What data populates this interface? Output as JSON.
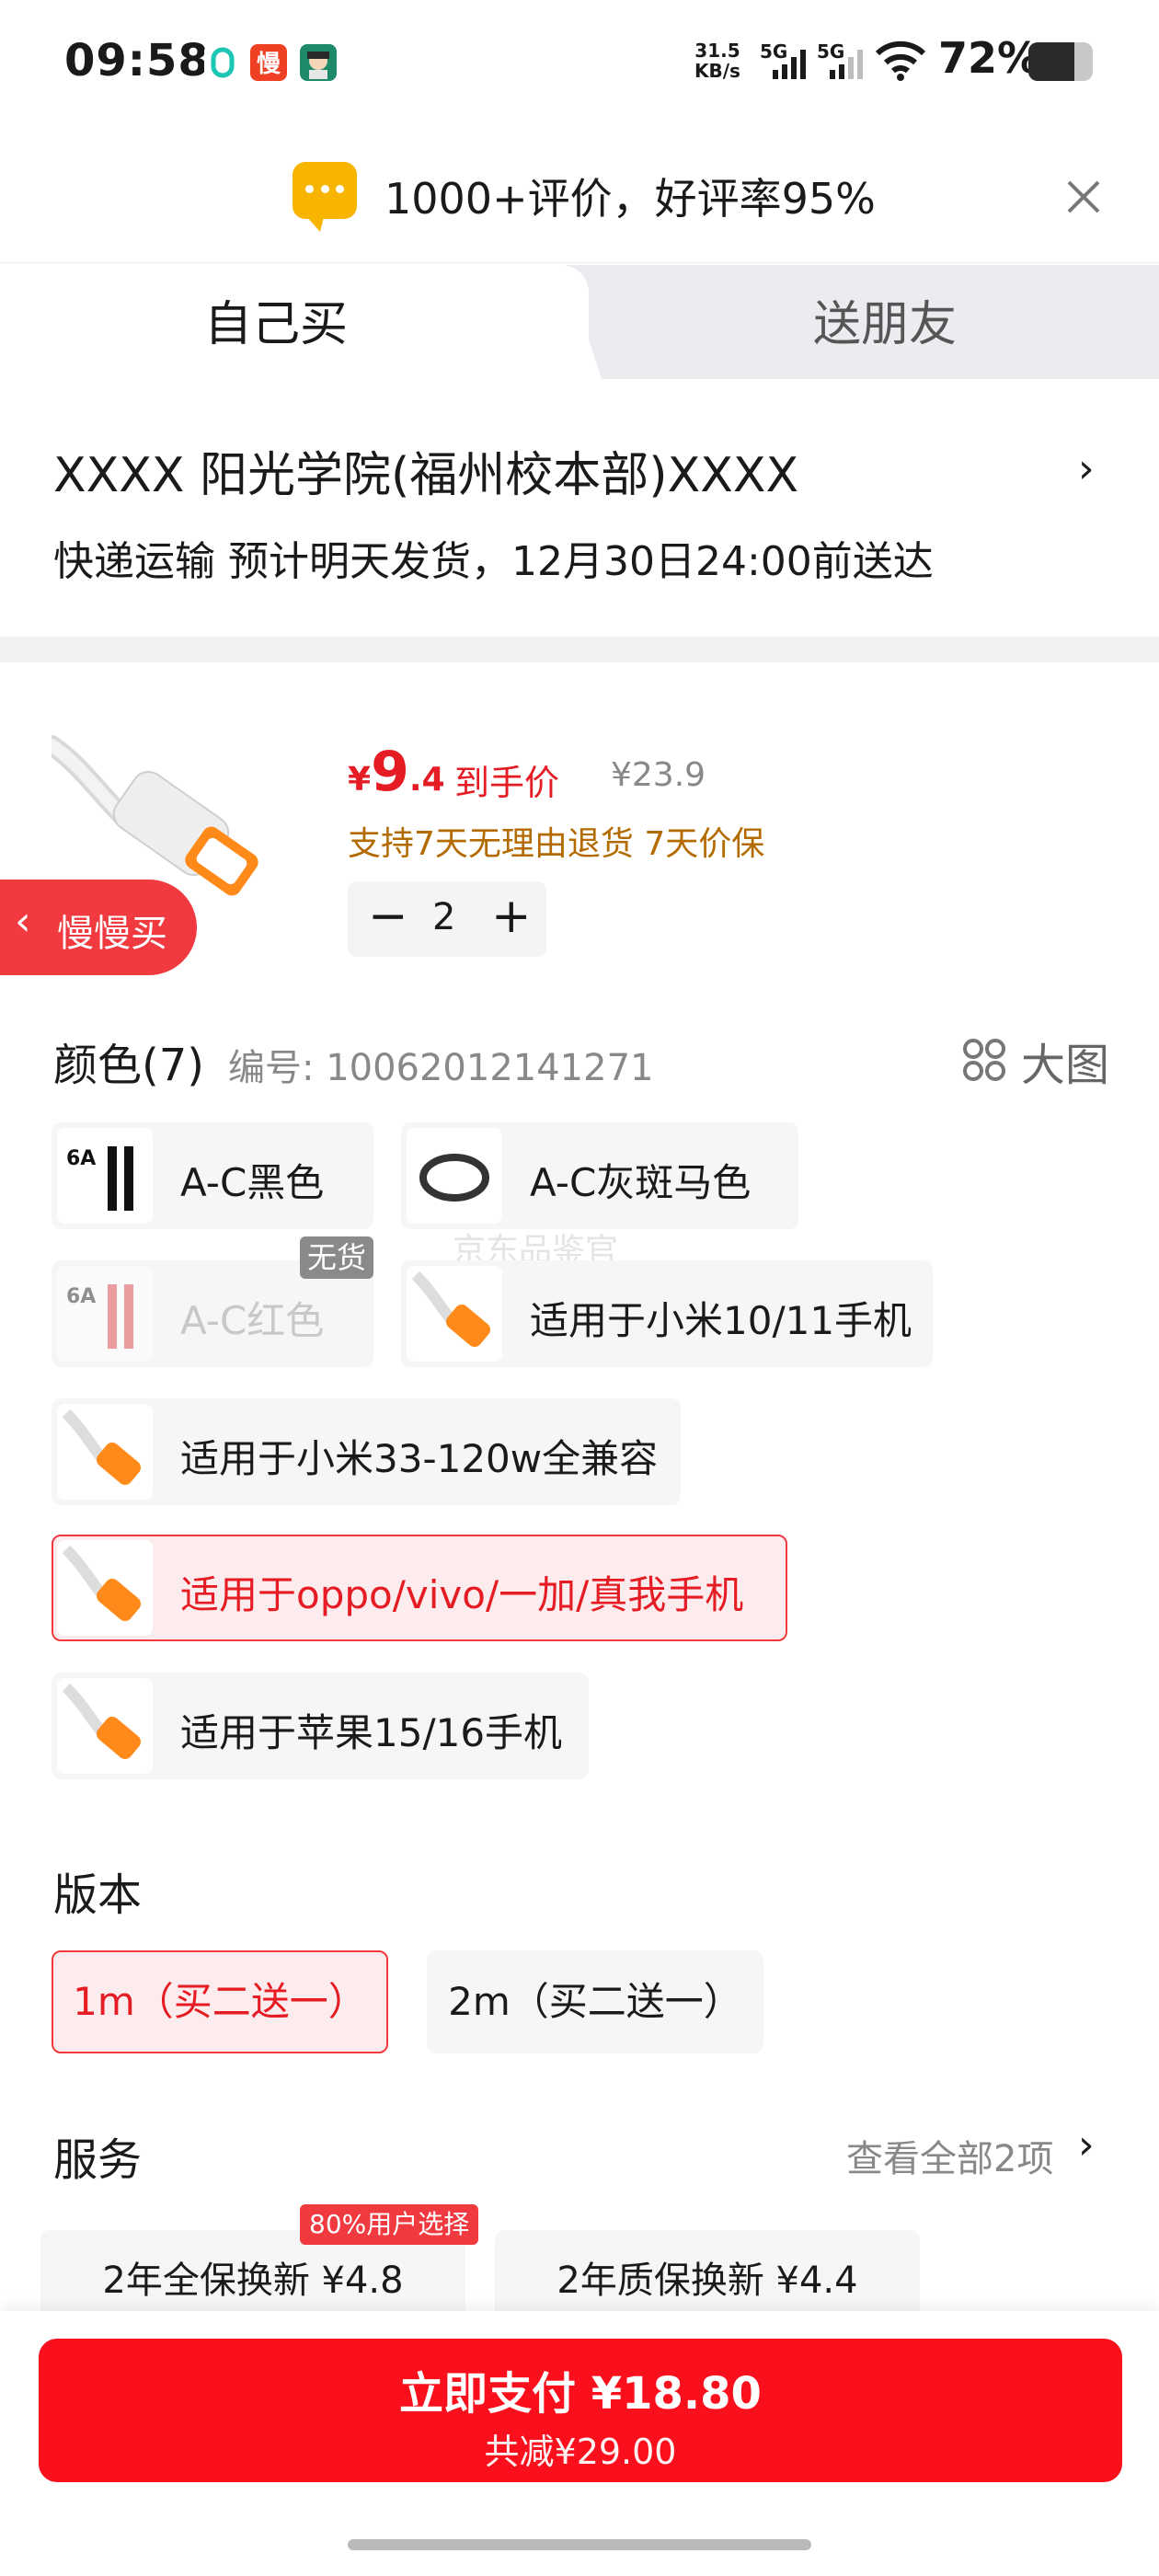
{
  "status_bar": {
    "time": "09:58",
    "net_speed_value": "31.5",
    "net_speed_unit": "KB/s",
    "signal_1": "5G",
    "signal_2": "5G",
    "battery_pct": "72%",
    "battery_level": 0.72
  },
  "review_banner": {
    "text": "1000+评价，好评率95%"
  },
  "tabs": {
    "self": "自己买",
    "gift": "送朋友"
  },
  "address": {
    "line1": "XXXX  阳光学院(福州校本部)XXXX",
    "line2": "快递运输 预计明天发货，12月30日24:00前送达",
    "chevron": "›"
  },
  "product": {
    "currency": "¥",
    "price_int": "9",
    "price_dec": ".4",
    "price_label": "到手价",
    "original_price": "¥23.9",
    "guarantee": "支持7天无理由退货  7天价保",
    "quantity": "2",
    "minus": "−",
    "plus": "+"
  },
  "back_pill": {
    "label": "慢慢买"
  },
  "color_section": {
    "title": "颜色(7)",
    "code": "编号: 10062012141271",
    "big_image": "大图",
    "no_stock": "无货",
    "watermark": "京东品鉴官",
    "options": [
      {
        "label": "A-C黑色",
        "selected": false,
        "disabled": false
      },
      {
        "label": "A-C灰斑马色",
        "selected": false,
        "disabled": false
      },
      {
        "label": "A-C红色",
        "selected": false,
        "disabled": true
      },
      {
        "label": "适用于小米10/11手机",
        "selected": false,
        "disabled": false
      },
      {
        "label": "适用于小米33-120w全兼容",
        "selected": false,
        "disabled": false
      },
      {
        "label": "适用于oppo/vivo/一加/真我手机",
        "selected": true,
        "disabled": false
      },
      {
        "label": "适用于苹果15/16手机",
        "selected": false,
        "disabled": false
      }
    ],
    "thumb_text": "6A"
  },
  "version_section": {
    "title": "版本",
    "options": [
      {
        "label": "1m（买二送一）",
        "selected": true
      },
      {
        "label": "2m（买二送一）",
        "selected": false
      }
    ]
  },
  "service_section": {
    "title": "服务",
    "view_all": "查看全部2项",
    "chevron": "›",
    "badge": "80%用户选择",
    "options": [
      {
        "label": "2年全保换新  ¥4.8"
      },
      {
        "label": "2年质保换新  ¥4.4"
      }
    ]
  },
  "checkout": {
    "pay_label": "立即支付 ¥18.80",
    "discount_label": "共减¥29.00"
  },
  "colors": {
    "accent": "#e51c23",
    "pay_button": "#fa0f1d",
    "orange_text": "#b36b00",
    "banner_icon": "#f7b500"
  }
}
